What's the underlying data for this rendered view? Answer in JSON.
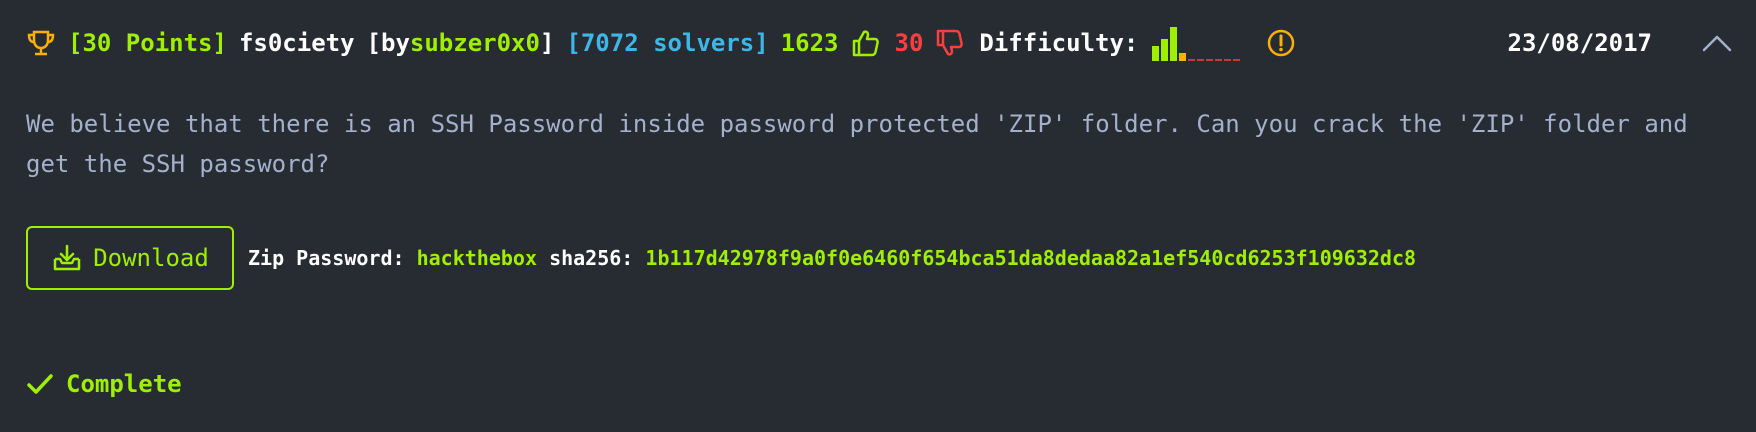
{
  "challenge": {
    "points": "[30 Points]",
    "name": "fs0ciety",
    "by_prefix": "[by ",
    "author": "subzer0x0",
    "by_suffix": "]",
    "solvers": "[7072 solvers]",
    "likes": "1623",
    "dislikes": "30",
    "difficulty_label": "Difficulty:",
    "date": "23/08/2017"
  },
  "difficulty": {
    "levels": [
      0.45,
      0.65,
      1.0,
      0.25,
      0,
      0,
      0,
      0,
      0,
      0
    ],
    "colors": {
      "filled": "#9fef00",
      "orange": "#ffaf00",
      "empty": "#ff3e3e"
    }
  },
  "description": {
    "text": "We believe that there is an SSH Password inside password protected 'ZIP' folder. Can you crack the 'ZIP' folder and get the SSH password?"
  },
  "download": {
    "button_label": "Download",
    "zip_password_label": "Zip Password:",
    "zip_password": "hackthebox",
    "sha_label": "sha256:",
    "sha": "1b117d42978f9a0f0e6460f654bca51da8dedaa82a1ef540cd6253f109632dc8"
  },
  "status": {
    "label": "Complete"
  },
  "icons": {
    "trophy": "trophy-icon",
    "like": "thumbs-up-icon",
    "dislike": "thumbs-down-icon",
    "warning": "warning-icon",
    "collapse": "chevron-up-icon",
    "download": "download-icon",
    "check": "check-icon"
  },
  "colors": {
    "background": "#272c33",
    "accent": "#9fef00",
    "blue": "#3fb6e8",
    "red": "#ff3e3e",
    "orange": "#ffaf00",
    "muted": "#a4b1cd"
  }
}
